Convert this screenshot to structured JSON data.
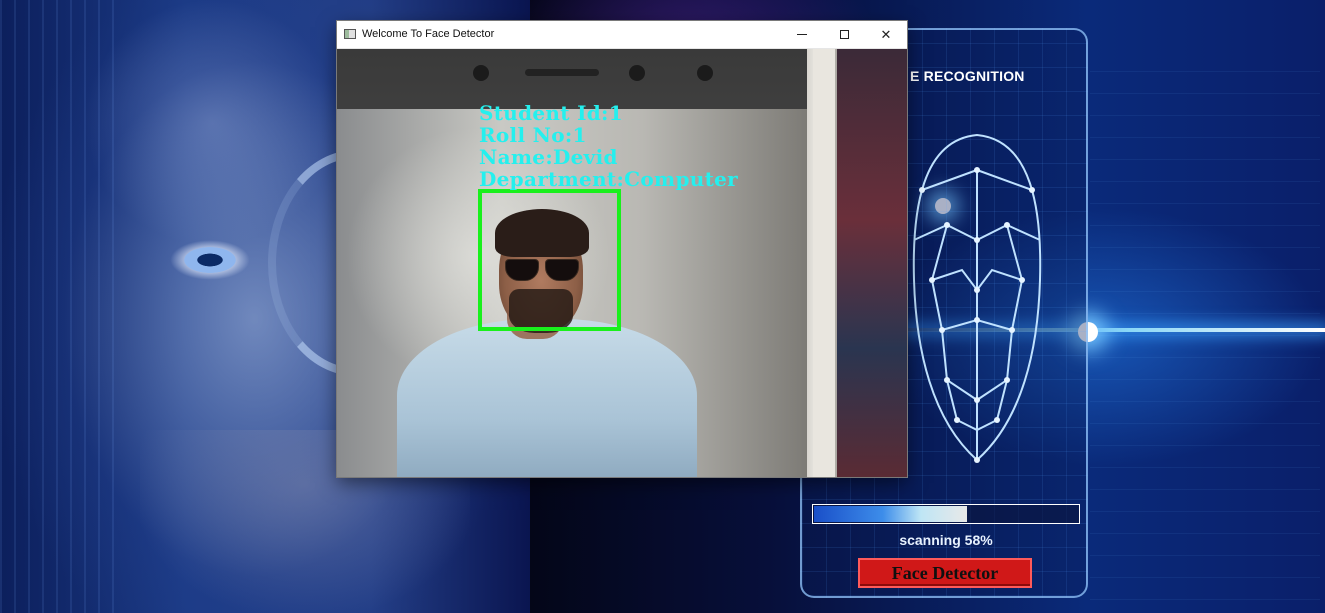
{
  "window": {
    "title": "Welcome To Face Detector",
    "minimize_glyph": "",
    "maximize_glyph": "",
    "close_glyph": "✕"
  },
  "detection": {
    "student_id": "Student Id:1",
    "roll_no": "Roll No:1",
    "name": "Name:Devid",
    "department": "Department:Computer"
  },
  "scanner": {
    "title": "E RECOGNITION",
    "status_text": "scanning 58%",
    "progress": 0.58,
    "button_label": "Face Detector"
  },
  "colors": {
    "overlay_text": "#24f0ee",
    "face_box": "#19f01c",
    "button_bg": "#d01818"
  },
  "icons": {
    "app_icon": "window-app-icon",
    "minimize": "minimize-icon",
    "maximize": "maximize-icon",
    "close": "close-icon"
  }
}
